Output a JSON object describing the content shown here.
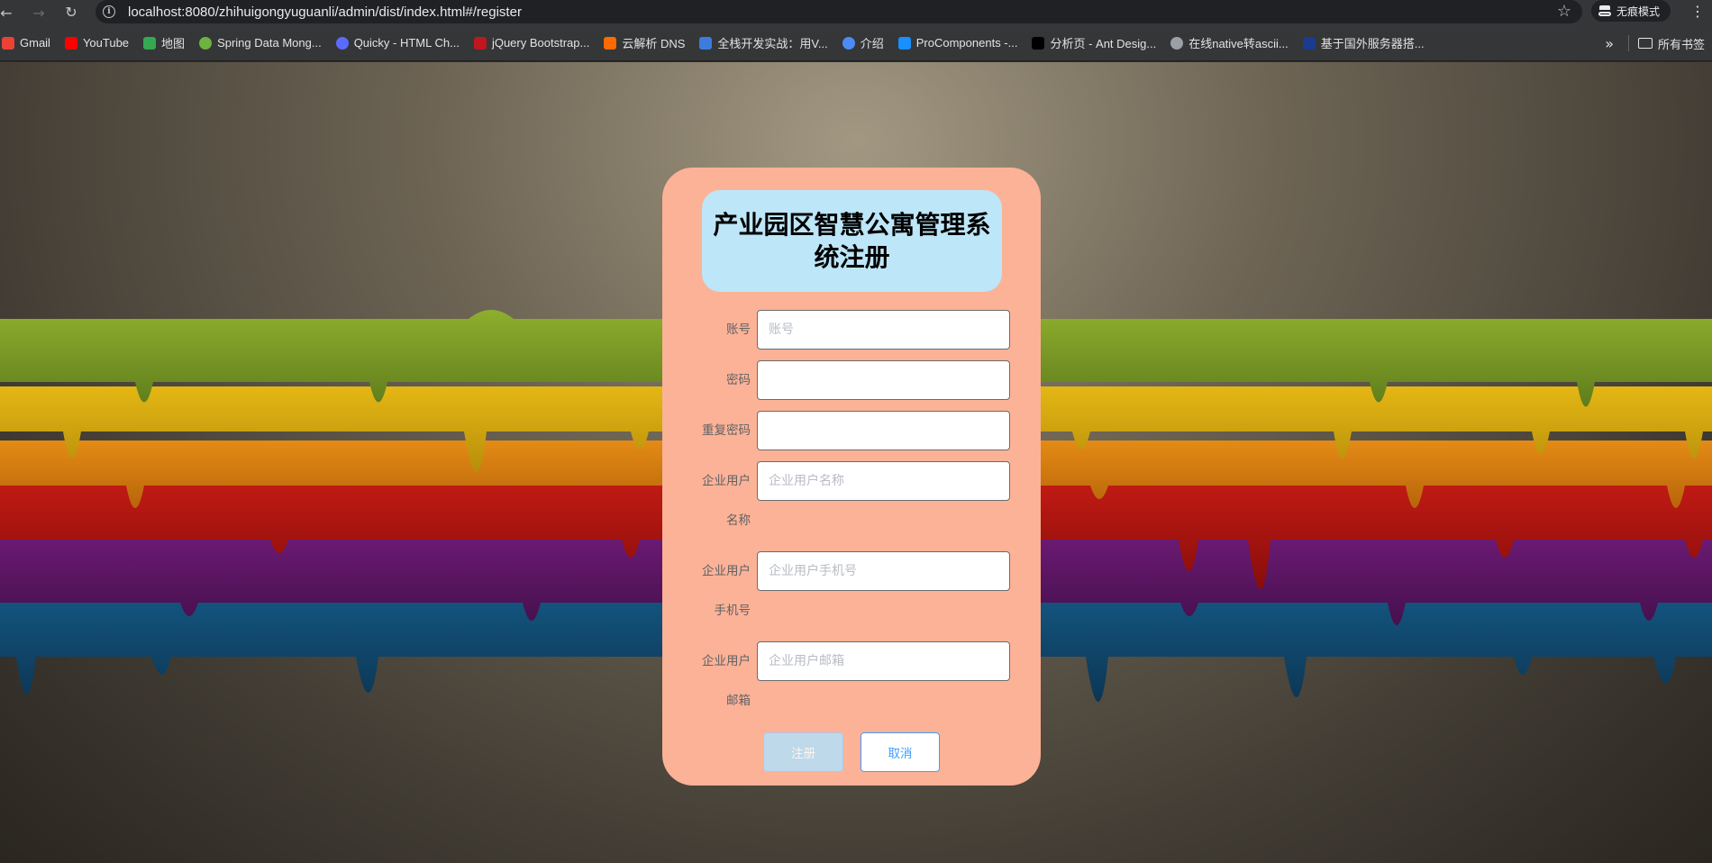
{
  "browser": {
    "url": "localhost:8080/zhihuigongyuguanli/admin/dist/index.html#/register",
    "incognito_label": "无痕模式",
    "all_bookmarks_label": "所有书签",
    "bookmarks": [
      {
        "label": "Gmail",
        "icon": "gmail-icon",
        "color": "#ea4335"
      },
      {
        "label": "YouTube",
        "icon": "youtube-icon",
        "color": "#ff0000"
      },
      {
        "label": "地图",
        "icon": "maps-icon",
        "color": "#34a853"
      },
      {
        "label": "Spring Data Mong...",
        "icon": "spring-icon",
        "color": "#6db33f"
      },
      {
        "label": "Quicky - HTML Ch...",
        "icon": "quicky-icon",
        "color": "#5b6bff"
      },
      {
        "label": "jQuery Bootstrap...",
        "icon": "jquery-icon",
        "color": "#c0171e"
      },
      {
        "label": "云解析 DNS",
        "icon": "aliyun-icon",
        "color": "#ff6a00"
      },
      {
        "label": "全栈开发实战：用V...",
        "icon": "m-icon",
        "color": "#3b7ddd"
      },
      {
        "label": "介绍",
        "icon": "intro-icon",
        "color": "#4c8bf5"
      },
      {
        "label": "ProComponents -...",
        "icon": "antd-icon",
        "color": "#1890ff"
      },
      {
        "label": "分析页 - Ant Desig...",
        "icon": "pro-icon",
        "color": "#000000"
      },
      {
        "label": "在线native转ascii...",
        "icon": "globe-icon",
        "color": "#9aa0a6"
      },
      {
        "label": "基于国外服务器搭...",
        "icon": "flag-icon",
        "color": "#1a3b8f"
      }
    ]
  },
  "form": {
    "title": "产业园区智慧公寓管理系统注册",
    "fields": [
      {
        "label": "账号",
        "placeholder": "账号",
        "value": ""
      },
      {
        "label": "密码",
        "placeholder": "",
        "value": ""
      },
      {
        "label": "重复密码",
        "placeholder": "",
        "value": ""
      },
      {
        "label": "企业用户名称",
        "placeholder": "企业用户名称",
        "value": ""
      },
      {
        "label": "企业用户手机号",
        "placeholder": "企业用户手机号",
        "value": ""
      },
      {
        "label": "企业用户邮箱",
        "placeholder": "企业用户邮箱",
        "value": ""
      }
    ],
    "submit_label": "注册",
    "cancel_label": "取消"
  },
  "colors": {
    "card_bg": "#fcb297",
    "title_bg": "#bde6f8",
    "primary_button": "#b3e0f9",
    "cancel_border": "#409eff"
  }
}
